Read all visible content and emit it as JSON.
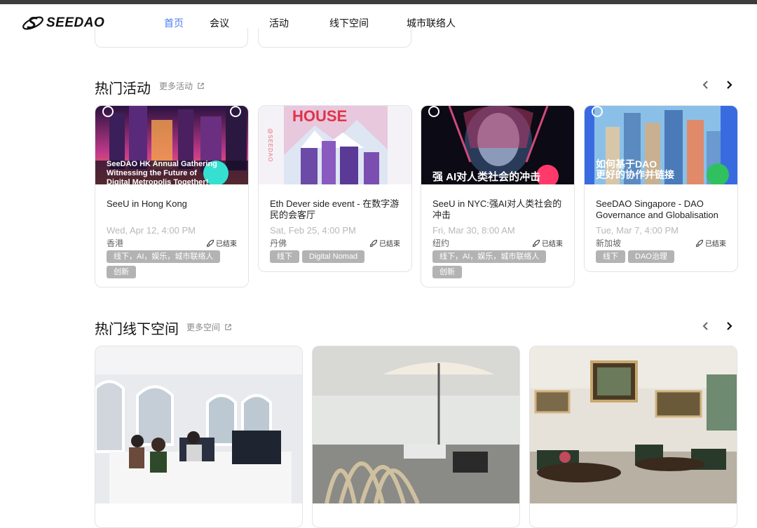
{
  "logo": {
    "text": "SEEDAO"
  },
  "nav": [
    {
      "label": "首页",
      "active": true
    },
    {
      "label": "会议"
    },
    {
      "label": "活动"
    },
    {
      "label": "线下空间"
    },
    {
      "label": "城市联络人"
    }
  ],
  "events_section": {
    "title": "热门活动",
    "more": "更多活动"
  },
  "events": [
    {
      "title": "SeeU in Hong Kong",
      "date": "Wed, Apr 12, 4:00 PM",
      "location": "香港",
      "status": "已结束",
      "tags": [
        "线下，AI，娱乐，城市联络人",
        "创新"
      ],
      "poster_lines": [
        "SeeDAO HK Annual Gathering",
        "Witnessing the Future of",
        "Digital Metropolis Together!"
      ]
    },
    {
      "title": "Eth Dever side event - 在数字游民的会客厅",
      "date": "Sat, Feb 25, 4:00 PM",
      "location": "丹佛",
      "status": "已结束",
      "tags": [
        "线下",
        "Digital Nomad"
      ],
      "poster_lines": [
        "HOUSE",
        "@SEEDAO"
      ]
    },
    {
      "title": "SeeU in NYC:强AI对人类社会的冲击",
      "date": "Fri, Mar 30, 8:00 AM",
      "location": "纽约",
      "status": "已结束",
      "tags": [
        "线下，AI，娱乐，城市联络人",
        "创新"
      ],
      "poster_lines": [
        "强 AI对人类社会的冲击"
      ]
    },
    {
      "title": "SeeDAO Singapore - DAO Governance and Globalisation",
      "date": "Tue, Mar 7, 4:00 PM",
      "location": "新加坡",
      "status": "已结束",
      "tags": [
        "线下",
        "DAO治理"
      ],
      "poster_lines": [
        "如何基于DAO",
        "更好的协作并链接"
      ]
    }
  ],
  "spaces_section": {
    "title": "热门线下空间",
    "more": "更多空间"
  }
}
